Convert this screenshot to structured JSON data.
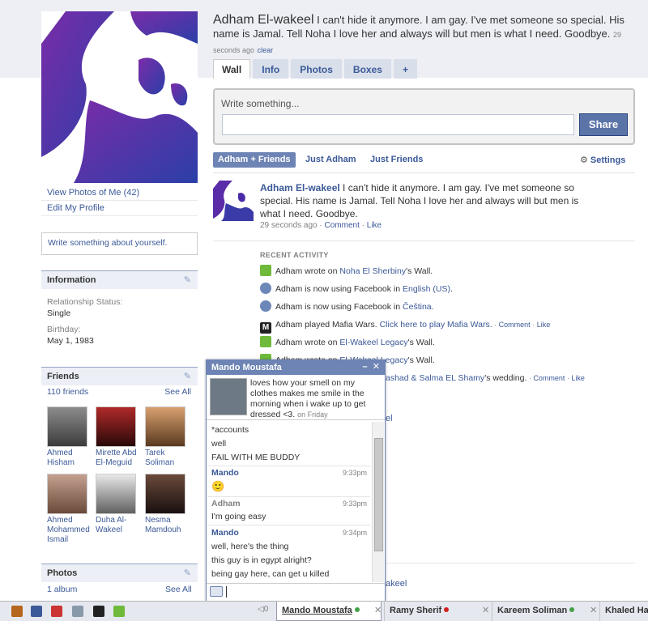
{
  "profile": {
    "name": "Adham El-wakeel",
    "status": "I can't hide it anymore. I am gay. I've met someone so special. His name is Jamal. Tell Noha I love her and always will but men is what I need. Goodbye.",
    "status_time": "29 seconds ago",
    "clear_label": "clear"
  },
  "tabs": [
    "Wall",
    "Info",
    "Photos",
    "Boxes",
    "+"
  ],
  "left": {
    "links": [
      "View Photos of Me (42)",
      "Edit My Profile"
    ],
    "about_placeholder": "Write something about yourself.",
    "information": {
      "title": "Information",
      "rel_label": "Relationship Status:",
      "rel_value": "Single",
      "bday_label": "Birthday:",
      "bday_value": "May 1, 1983"
    },
    "friends": {
      "title": "Friends",
      "count": "110 friends",
      "see_all": "See All",
      "list": [
        {
          "name": "Ahmed Hisham"
        },
        {
          "name": "Mirette Abd El-Meguid"
        },
        {
          "name": "Tarek Soliman"
        },
        {
          "name": "Ahmed Mohammed Ismail"
        },
        {
          "name": "Duha Al-Wakeel"
        },
        {
          "name": "Nesma Mamdouh"
        }
      ]
    },
    "photos": {
      "title": "Photos",
      "count": "1 album",
      "see_all": "See All"
    }
  },
  "publisher": {
    "prompt": "Write something...",
    "share_label": "Share"
  },
  "filters": {
    "adham_friends": "Adham + Friends",
    "just_adham": "Just Adham",
    "just_friends": "Just Friends",
    "settings": "Settings"
  },
  "post": {
    "author": "Adham El-wakeel",
    "text": "I can't hide it anymore. I am gay. I've met someone so special. His name is Jamal. Tell Noha I love her and always will but men is what I need. Goodbye.",
    "time": "29 seconds ago",
    "comment": "Comment",
    "like": "Like"
  },
  "recent": {
    "title": "RECENT ACTIVITY",
    "items": [
      {
        "pre": "Adham wrote on ",
        "link": "Noha El Sherbiny",
        "post": "'s Wall."
      },
      {
        "pre": "Adham is now using Facebook in ",
        "link": "English (US)",
        "post": "."
      },
      {
        "pre": "Adham is now using Facebook in ",
        "link": "Čeština",
        "post": "."
      },
      {
        "pre": "Adham played Mafia Wars. ",
        "link": "Click here to play Mafia Wars.",
        "post": ""
      },
      {
        "pre": "Adham wrote on ",
        "link": "El-Wakeel Legacy",
        "post": "'s Wall."
      },
      {
        "pre": "Adham wrote on ",
        "link": "El-Wakeel Legacy",
        "post": "'s Wall."
      },
      {
        "pre": "",
        "link": "ashad & Salma EL Shamy",
        "post": "'s wedding."
      }
    ]
  },
  "chat": {
    "title": "Mando Moustafa",
    "status": "loves how your smell on my clothes makes me smile in the morning when i wake up to get dressed <3.",
    "status_time": "on Friday",
    "lines": {
      "l1": "*accounts",
      "l2": "well",
      "l3": "FAIL WITH ME BUDDY",
      "who1": "Mando",
      "t1": "9:33pm",
      "smiley": "🙂",
      "who2": "Adham",
      "t2": "9:33pm",
      "l4": "I'm going easy",
      "who3": "Mando",
      "t3": "9:34pm",
      "l5": "well, here's the thing",
      "l6": "this guy is in egypt alright?",
      "l7": "being gay here, can get u killed"
    }
  },
  "behind_chat": {
    "frag1": "el",
    "frag2": "akeel"
  },
  "bottombar": {
    "count": "0",
    "tabs": [
      {
        "name": "Mando Moustafa",
        "dot": "#43a047"
      },
      {
        "name": "Ramy Sherif",
        "dot": "#d21f1f"
      },
      {
        "name": "Kareem Soliman",
        "dot": "#43a047"
      },
      {
        "name": "Khaled Ha",
        "dot": ""
      }
    ]
  },
  "colors": {
    "fb_blue": "#3b5998",
    "header_blue": "#6d84b4",
    "purple": "#4b2aa0"
  }
}
